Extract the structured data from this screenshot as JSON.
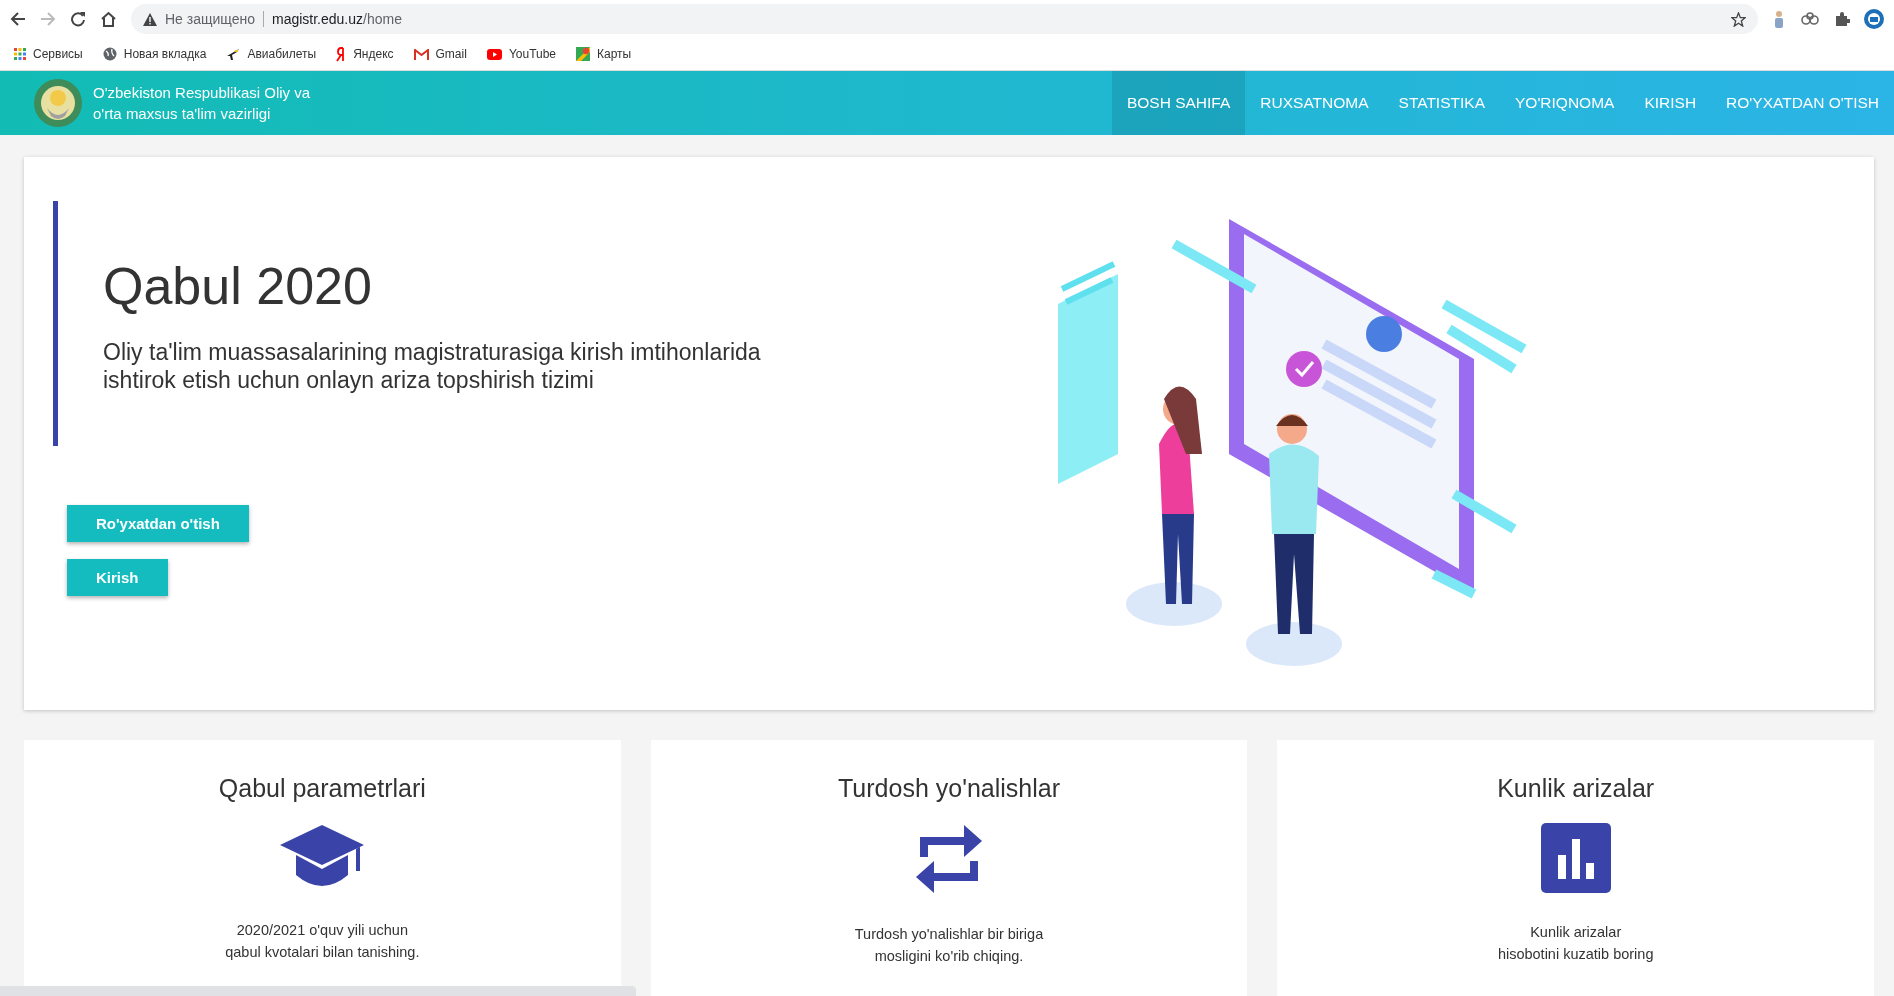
{
  "browser": {
    "security": "Не защищено",
    "url_host": "magistr.edu.uz",
    "url_path": "/home",
    "bookmarks": [
      {
        "label": "Сервисы",
        "kind": "apps"
      },
      {
        "label": "Новая вкладка",
        "kind": "globe"
      },
      {
        "label": "Авиабилеты",
        "kind": "plane"
      },
      {
        "label": "Яндекс",
        "kind": "yandex"
      },
      {
        "label": "Gmail",
        "kind": "gmail"
      },
      {
        "label": "YouTube",
        "kind": "youtube"
      },
      {
        "label": "Карты",
        "kind": "maps"
      }
    ]
  },
  "header": {
    "org_name": "O'zbekiston Respublikasi Oliy va\no'rta maxsus ta'lim vazirligi",
    "nav": [
      {
        "label": "BOSH SAHIFA",
        "selected": true
      },
      {
        "label": "RUXSATNOMA",
        "selected": false
      },
      {
        "label": "STATISTIKA",
        "selected": false
      },
      {
        "label": "YO'RIQNOMA",
        "selected": false
      },
      {
        "label": "KIRISH",
        "selected": false
      },
      {
        "label": "RO'YXATDAN O'TISH",
        "selected": false
      }
    ]
  },
  "hero": {
    "title": "Qabul 2020",
    "subtitle": "Oliy ta'lim muassasalarining magistraturasiga kirish imtihonlarida\nishtirok etish uchun onlayn ariza topshirish tizimi",
    "buttons": [
      "Ro'yxatdan o'tish",
      "Kirish"
    ]
  },
  "cards": [
    {
      "title": "Qabul parametrlari",
      "kind": "cap",
      "text": "2020/2021 o'quv yili uchun\nqabul kvotalari bilan tanishing."
    },
    {
      "title": "Turdosh yo'nalishlar",
      "kind": "swap",
      "text": "Turdosh yo'nalishlar bir biriga\nmosligini ko'rib chiqing."
    },
    {
      "title": "Kunlik arizalar",
      "kind": "chart",
      "text": "Kunlik arizalar\nhisobotini kuzatib boring"
    }
  ]
}
